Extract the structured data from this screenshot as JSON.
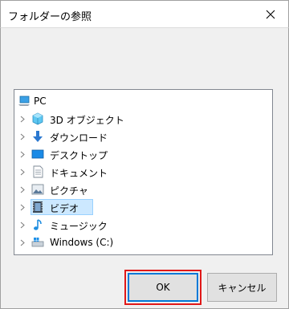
{
  "window": {
    "title": "フォルダーの参照"
  },
  "tree": {
    "root": {
      "label": "PC",
      "icon": "pc-icon"
    },
    "items": [
      {
        "label": "3D オブジェクト",
        "icon": "3d-objects-icon"
      },
      {
        "label": "ダウンロード",
        "icon": "download-arrow-icon"
      },
      {
        "label": "デスクトップ",
        "icon": "desktop-icon"
      },
      {
        "label": "ドキュメント",
        "icon": "document-icon"
      },
      {
        "label": "ピクチャ",
        "icon": "pictures-icon"
      },
      {
        "label": "ビデオ",
        "icon": "video-icon",
        "selected": true
      },
      {
        "label": "ミュージック",
        "icon": "music-note-icon"
      },
      {
        "label": "Windows (C:)",
        "icon": "drive-icon"
      }
    ]
  },
  "buttons": {
    "ok_label": "OK",
    "cancel_label": "キャンセル"
  },
  "colors": {
    "accent": "#0078d7",
    "highlight_box": "#e01818",
    "selection": "#cce8ff"
  }
}
